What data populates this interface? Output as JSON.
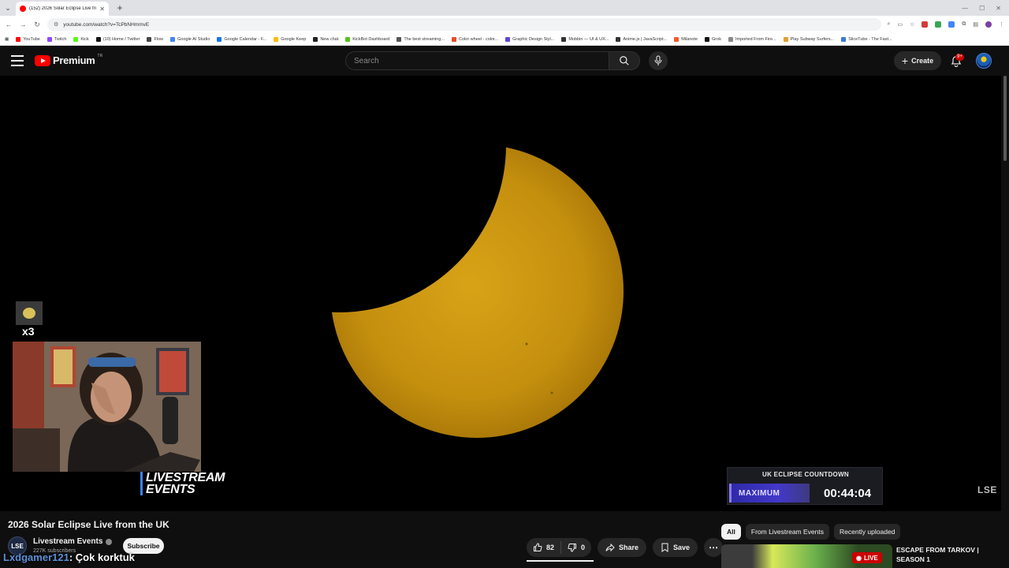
{
  "browser": {
    "tab_title": "(152) 2026 Solar Eclipse Live fro...",
    "url": "youtube.com/watch?v=TcPbNHmmvE",
    "bookmarks": [
      "YouTube",
      "Twitch",
      "Kick",
      "(10) Home / Twitter",
      "Flow",
      "Google AI Studio",
      "Google Calendar - F...",
      "Google Keep",
      "New chat",
      "KickBot Dashboard",
      "The best streaming...",
      "Color wheel - color...",
      "Graphic Design Styl...",
      "Mobbin — UI & UX...",
      "Anime.js | JavaScript...",
      "Milanote",
      "Grok",
      "Imported From Fire...",
      "Play Subway Surfers...",
      "SliceTube - The Fast..."
    ]
  },
  "header": {
    "logo_text": "Premium",
    "logo_region": "TR",
    "search_placeholder": "Search",
    "create_label": "Create",
    "notification_count": "9+"
  },
  "player": {
    "sticker_count": "x3",
    "brand_line1": "LIVESTREAM",
    "brand_line2": "EVENTS",
    "countdown_title": "UK ECLIPSE COUNTDOWN",
    "countdown_phase": "MAXIMUM",
    "countdown_time": "00:44:04",
    "corner_logo": "LSE"
  },
  "video": {
    "title": "2026 Solar Eclipse Live from the UK",
    "channel_avatar": "LSE",
    "channel_name": "Livestream Events",
    "subscribers": "227K subscribers",
    "subscribe_label": "Subscribe",
    "likes": "82",
    "dislikes": "0",
    "like_ratio": 1.0,
    "share_label": "Share",
    "save_label": "Save"
  },
  "chat_overlay": {
    "user": "Lxdgamer121",
    "message": ": Çok korktuk"
  },
  "sidebar": {
    "filters": [
      "All",
      "From Livestream Events",
      "Recently uploaded"
    ],
    "rec_title": "ESCAPE FROM TARKOV | SEASON 1",
    "rec_badge": "LIVE"
  }
}
